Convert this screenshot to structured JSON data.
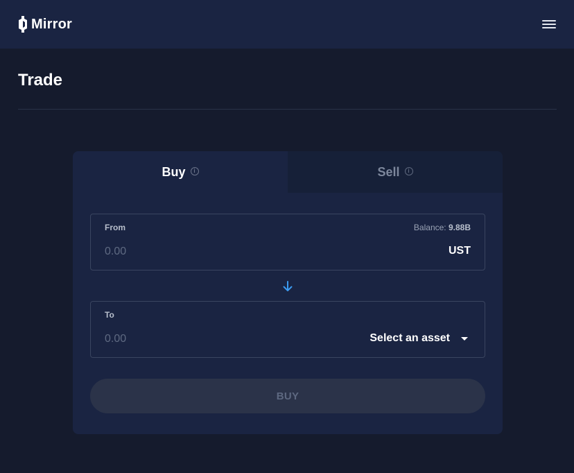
{
  "app": {
    "name": "Mirror"
  },
  "page": {
    "title": "Trade"
  },
  "tabs": [
    {
      "label": "Buy",
      "active": true
    },
    {
      "label": "Sell",
      "active": false
    }
  ],
  "from_field": {
    "label": "From",
    "balance_label": "Balance:",
    "balance_value": "9.88B",
    "placeholder": "0.00",
    "unit": "UST"
  },
  "to_field": {
    "label": "To",
    "placeholder": "0.00",
    "asset_select_label": "Select an asset"
  },
  "action": {
    "buy_label": "BUY"
  },
  "icons": {
    "menu": "hamburger-menu-icon",
    "info": "info-icon",
    "arrow": "arrow-down-icon",
    "caret": "caret-down-icon"
  },
  "colors": {
    "background": "#151b2d",
    "header": "#1a2442",
    "card": "#1a2442",
    "accent": "#3b9af0",
    "disabled_button": "#2b3349"
  }
}
